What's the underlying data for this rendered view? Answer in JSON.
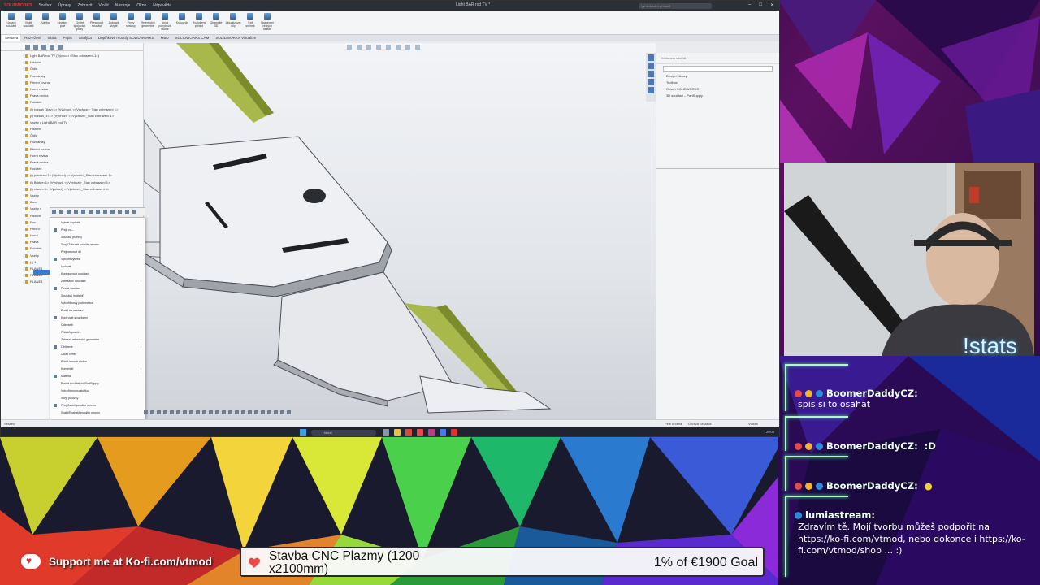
{
  "solidworks": {
    "app_logo": "SOLIDWORKS",
    "menu": [
      "Soubor",
      "Úpravy",
      "Zobrazit",
      "Vložit",
      "Nástroje",
      "Okno",
      "Nápověda"
    ],
    "title": "Light BAR rod TV *",
    "search_placeholder": "Vyhledávání příkazů",
    "tabs": [
      "Sestava",
      "Rozvržení",
      "Skica",
      "Popis",
      "Analýza",
      "Doplňkové moduly SOLIDWORKS",
      "MBD",
      "SOLIDWORKS CAM",
      "SOLIDWORKS Visualize"
    ],
    "active_tab_index": 0,
    "ribbon_buttons": [
      "Upravit součást",
      "Vložit součásti",
      "Vazba",
      "Lineární pole",
      "Chytré spojovací prvky",
      "Přesunout součást",
      "Zobrazit skryté",
      "Prvky sestavy",
      "Referenční geometrie",
      "Nová pohybová studie",
      "Kusovník",
      "Rozložený pohled",
      "Okamžité 3D",
      "Aktualizovat díly",
      "Vzít snímek",
      "Nastavení velkých sestav"
    ],
    "tree_rows": [
      "Light BAR rod TV (Výchozí <Stav zobrazení-1>)",
      "Historie",
      "Čidla",
      "Poznámky",
      "Přední rovina",
      "Horní rovina",
      "Pravá rovina",
      "Počátek",
      "(f) rozsah_1lev<1> (Výchozí) <<Výchozí>_Stav zobrazení 1>",
      "(f) rozsah_1<1> (Výchozí) <<Výchozí>_Stav zobrazení 1>",
      "Vazby v Light BAR rod TV",
      "Historie",
      "Čidla",
      "Poznámky",
      "Přední rovina",
      "Horní rovina",
      "Pravá rovina",
      "Počátek",
      "(f) pointkar<1> (Výchozí) <<Výchozí>_Stav zobrazení 1>",
      "(f) Bridge<1> (Výchozí) <<Výchozí>_Stav zobrazení 1>",
      "(f) clamp<1> (Výchozí) <<Výchozí>_Stav zobrazení 1>",
      "Vazby",
      "Zam",
      "Vazby v",
      "Historie",
      "Poz",
      "Přední",
      "Horní",
      "Pravá",
      "Počátek",
      "Vazby",
      "(-) 1",
      "PLANE1",
      "PLANE2",
      "PLANE3"
    ],
    "context_menu": [
      {
        "label": "Vybrat doplněk",
        "sub": false
      },
      {
        "label": "Přejít na...",
        "sub": false
      },
      {
        "label": "Součást (Bohm)",
        "sub": false
      },
      {
        "label": "Skrýt/Zobrazit položky stromu",
        "sub": true
      },
      {
        "label": "Přejmenovat díl",
        "sub": false
      },
      {
        "label": "Vytvořit výkres",
        "sub": false
      },
      {
        "label": "Izolovat",
        "sub": false
      },
      {
        "label": "Konfigurovat součást",
        "sub": false
      },
      {
        "label": "Zobrazení součásti",
        "sub": true
      },
      {
        "label": "Pevná součást",
        "sub": false
      },
      {
        "label": "Součásti (potlačit)",
        "sub": false
      },
      {
        "label": "Vytvořit nový podsestava",
        "sub": false
      },
      {
        "label": "Zrušit na sestavu",
        "sub": false
      },
      {
        "label": "Kopírovat s vazbami",
        "sub": false
      },
      {
        "label": "Odstranit",
        "sub": false
      },
      {
        "label": "Přidat/Upravit...",
        "sub": false
      },
      {
        "label": "Zobrazit referenční geometrie",
        "sub": true
      },
      {
        "label": "Oblíbené",
        "sub": true
      },
      {
        "label": "Uložit výběr",
        "sub": false
      },
      {
        "label": "Přidat k nové složce",
        "sub": false
      },
      {
        "label": "Komentář",
        "sub": true
      },
      {
        "label": "Materiál",
        "sub": true
      },
      {
        "label": "Poslat součást do PartSupply",
        "sub": false
      },
      {
        "label": "Vytvořit novou složku",
        "sub": false
      },
      {
        "label": "Skrýt položky",
        "sub": false
      },
      {
        "label": "Přizpůsobit položku stromu",
        "sub": false
      },
      {
        "label": "Sbalit/Rozbalit položky stromu",
        "sub": false
      }
    ],
    "taskpane": {
      "header": "Knihovna návrhů",
      "items": [
        "Design Library",
        "Toolbox",
        "Obsah SOLIDWORKS",
        "3D součásti – PartSupply"
      ]
    },
    "status_left": "Sestavy",
    "status_right": [
      "Plně určená",
      "Úprava Sestava",
      "Vlastní"
    ],
    "taskbar_search": "Hledat",
    "taskbar_time": "20:06"
  },
  "overlay": {
    "stats_command": "!stats",
    "chat": [
      {
        "user": "BoomerDaddyCZ:",
        "text": "spis si to osahat",
        "badge_colors": [
          "#e84a4a",
          "#f2b233",
          "#2f8bd9"
        ]
      },
      {
        "user": "BoomerDaddyCZ:",
        "text": ":D",
        "badge_colors": [
          "#e84a4a",
          "#f2b233",
          "#2f8bd9"
        ]
      },
      {
        "user": "BoomerDaddyCZ:",
        "text": "●",
        "badge_colors": [
          "#e84a4a",
          "#f2b233",
          "#2f8bd9"
        ]
      },
      {
        "user": "lumiastream:",
        "text": "Zdravím tě. Mojí tvorbu můžeš podpořit na https://ko-fi.com/vtmod, nebo dokonce i https://ko-fi.com/vtmod/shop ... :)",
        "badge_colors": [
          "#2f8bd9"
        ]
      }
    ],
    "kofi_label": "Support me at Ko-fi.com/vtmod",
    "goal": {
      "title": "Stavba CNC Plazmy (1200 x2100mm)",
      "amount_label": "1% of €1900 Goal",
      "progress": 0.01
    }
  }
}
